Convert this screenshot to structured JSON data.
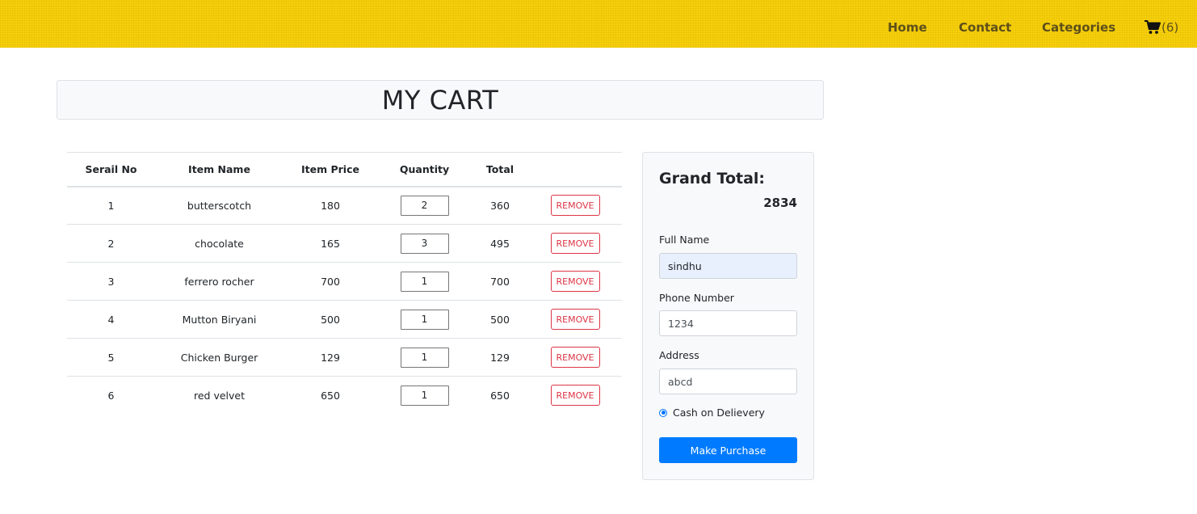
{
  "nav": {
    "home": "Home",
    "contact": "Contact",
    "categories": "Categories",
    "cart_count": "(6)",
    "brand_color": "#f7cf0a"
  },
  "page": {
    "title": "MY CART"
  },
  "table": {
    "headers": [
      "Serail No",
      "Item Name",
      "Item Price",
      "Quantity",
      "Total",
      ""
    ],
    "rows": [
      {
        "serial": "1",
        "name": "butterscotch",
        "price": "180",
        "quantity": "2",
        "total": "360",
        "action": "REMOVE"
      },
      {
        "serial": "2",
        "name": "chocolate",
        "price": "165",
        "quantity": "3",
        "total": "495",
        "action": "REMOVE"
      },
      {
        "serial": "3",
        "name": "ferrero rocher",
        "price": "700",
        "quantity": "1",
        "total": "700",
        "action": "REMOVE"
      },
      {
        "serial": "4",
        "name": "Mutton Biryani",
        "price": "500",
        "quantity": "1",
        "total": "500",
        "action": "REMOVE"
      },
      {
        "serial": "5",
        "name": "Chicken Burger",
        "price": "129",
        "quantity": "1",
        "total": "129",
        "action": "REMOVE"
      },
      {
        "serial": "6",
        "name": "red velvet",
        "price": "650",
        "quantity": "1",
        "total": "650",
        "action": "REMOVE"
      }
    ]
  },
  "summary": {
    "grand_total_label": "Grand Total:",
    "grand_total_value": "2834",
    "full_name_label": "Full Name",
    "full_name_value": "sindhu",
    "phone_label": "Phone Number",
    "phone_value": "1234",
    "address_label": "Address",
    "address_value": "abcd",
    "payment_option": "Cash on Delievery",
    "purchase_button": "Make Purchase",
    "button_color": "#007bff"
  },
  "icons": {
    "cart": "shopping-cart-icon"
  }
}
